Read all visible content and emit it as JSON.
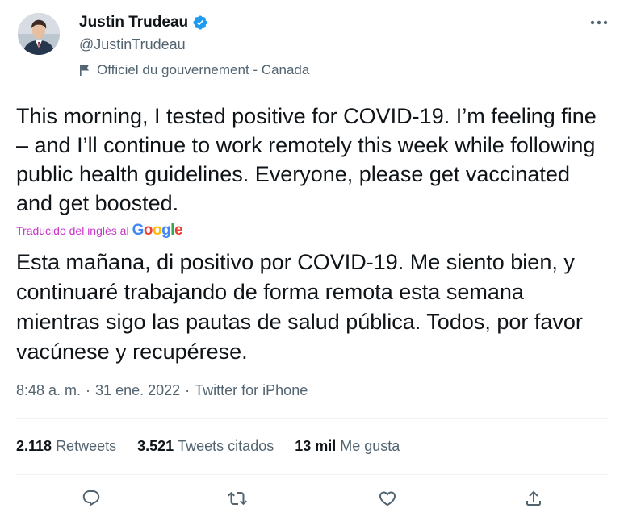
{
  "author": {
    "display_name": "Justin Trudeau",
    "handle": "@JustinTrudeau",
    "label": "Officiel du gouvernement - Canada",
    "verified": true
  },
  "tweet": {
    "text": "This morning, I tested positive for COVID-19. I’m feeling fine – and I’ll continue to work remotely this week while following public health guidelines. Everyone, please get vaccinated and get boosted.",
    "translated_by": "Traducido del inglés al",
    "translation_provider": "Google",
    "translation": "Esta mañana, di positivo por COVID-19. Me siento bien, y continuaré trabajando de forma remota esta semana mientras sigo las pautas de salud pública. Todos, por favor vacúnese y recupérese.",
    "time": "8:48 a. m.",
    "separator": "·",
    "date": "31 ene. 2022",
    "source": "Twitter for iPhone"
  },
  "stats": {
    "retweets_count": "2.118",
    "retweets_label": "Retweets",
    "quotes_count": "3.521",
    "quotes_label": "Tweets citados",
    "likes_count": "13 mil",
    "likes_label": "Me gusta"
  },
  "actions": [
    "reply-icon",
    "retweet-icon",
    "like-icon",
    "share-icon"
  ],
  "colors": {
    "text_primary": "#0f1419",
    "text_secondary": "#536471",
    "verified_blue": "#1d9bf0",
    "translation_magenta": "#c736c7",
    "divider": "#eff3f4"
  }
}
